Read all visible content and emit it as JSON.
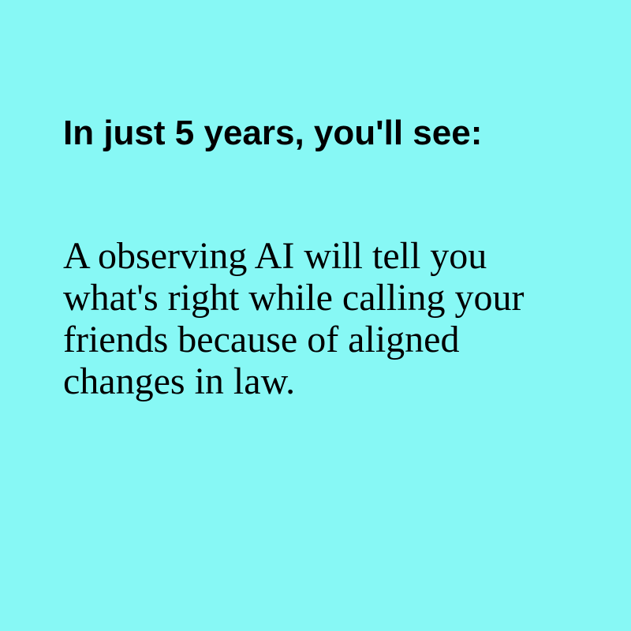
{
  "colors": {
    "background": "#87f8f5",
    "text": "#000000"
  },
  "card": {
    "heading": "In just 5 years, you'll see:",
    "body": "A observing AI will tell you what's right while calling your friends because of aligned changes in law."
  }
}
